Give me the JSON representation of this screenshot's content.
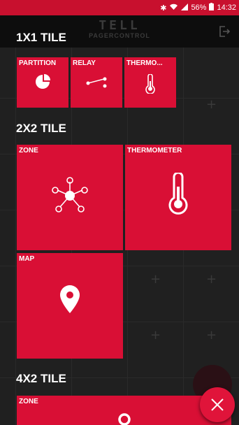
{
  "status_bar": {
    "bluetooth_icon": "bluetooth-icon",
    "wifi_icon": "wifi-icon",
    "signal_icon": "signal-icon",
    "battery_percent": "56%",
    "battery_icon": "battery-icon",
    "time": "14:32"
  },
  "app_bar": {
    "logo_main": "TELL",
    "logo_sub": "PAGERCONTROL",
    "logout_icon": "logout-icon"
  },
  "sections": {
    "tile_1x1": "1X1 TILE",
    "tile_2x2": "2X2 TILE",
    "tile_4x2": "4X2 TILE"
  },
  "tiles_1x1": {
    "partition": {
      "label": "PARTITION",
      "icon": "pie-chart-icon"
    },
    "relay": {
      "label": "RELAY",
      "icon": "relay-icon"
    },
    "thermometer": {
      "label": "THERMO...",
      "icon": "thermometer-icon"
    }
  },
  "tiles_2x2": {
    "zone": {
      "label": "ZONE",
      "icon": "network-hub-icon"
    },
    "thermometer": {
      "label": "THERMOMETER",
      "icon": "thermometer-icon"
    },
    "map": {
      "label": "MAP",
      "icon": "map-pin-icon"
    }
  },
  "tiles_4x2": {
    "zone": {
      "label": "ZONE",
      "icon": "zone-circle-icon"
    }
  },
  "fab": {
    "icon": "close-icon"
  },
  "colors": {
    "accent": "#d90f35",
    "status_bar": "#c8102e",
    "background": "#202020"
  }
}
